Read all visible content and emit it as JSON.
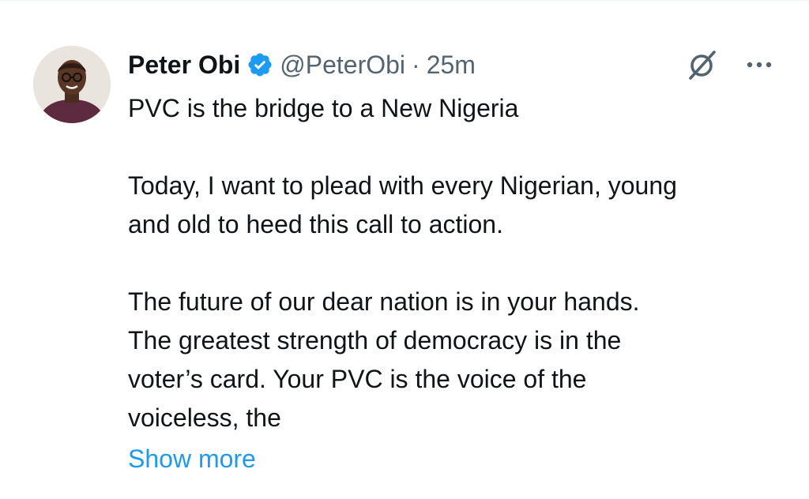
{
  "tweet": {
    "author_name": "Peter Obi",
    "handle": "@PeterObi",
    "separator": "·",
    "time": "25m",
    "title_line": "PVC is the bridge to a New Nigeria",
    "para1_line1": "Today, I want to plead with every Nigerian, young",
    "para1_line2": "and old to heed this call to action.",
    "para2_line1": "The future of our dear nation is in your hands.",
    "para2_line2": "The greatest strength of democracy is in the",
    "para2_line3": "voter’s card. Your PVC is the voice of the",
    "para2_line4": "voiceless, the",
    "show_more": "Show more"
  },
  "icons": {
    "verified": "verified-badge-icon",
    "grok": "grok-icon",
    "more": "more-options-icon"
  },
  "colors": {
    "text": "#0f1419",
    "secondary": "#536471",
    "link": "#1d9bf0",
    "verified": "#1d9bf0"
  }
}
